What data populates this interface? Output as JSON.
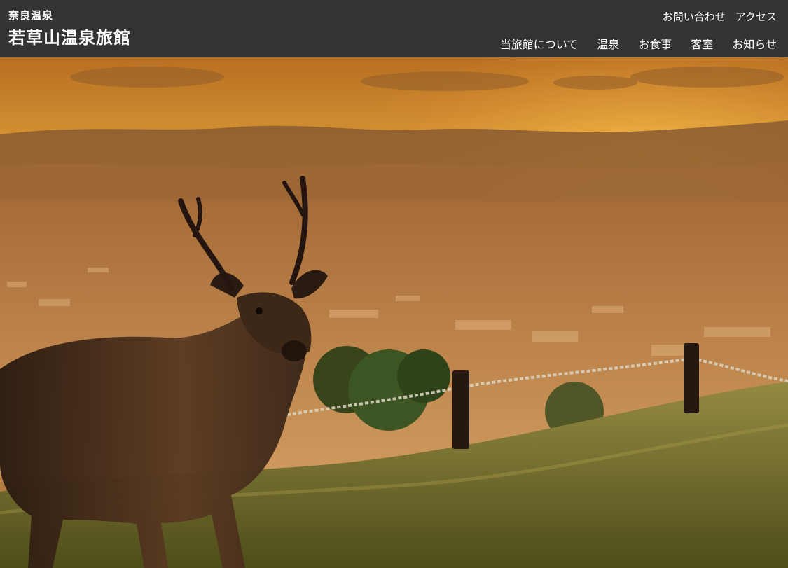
{
  "site": {
    "subtitle": "奈良温泉",
    "title": "若草山温泉旅館"
  },
  "utility_nav": [
    {
      "label": "お問い合わせ"
    },
    {
      "label": "アクセス"
    }
  ],
  "main_nav": [
    {
      "label": "当旅館について"
    },
    {
      "label": "温泉"
    },
    {
      "label": "お食事"
    },
    {
      "label": "客室"
    },
    {
      "label": "お知らせ"
    }
  ],
  "hero": {
    "image_subject": "deer-at-sunset",
    "sky_color": "#f1b63c",
    "glow_color": "#ffe08a",
    "city_color": "#c8894a",
    "hill_color": "#6f6428",
    "deer_color": "#3a2618"
  },
  "colors": {
    "header_bg": "#333333",
    "header_text": "#ffffff"
  }
}
